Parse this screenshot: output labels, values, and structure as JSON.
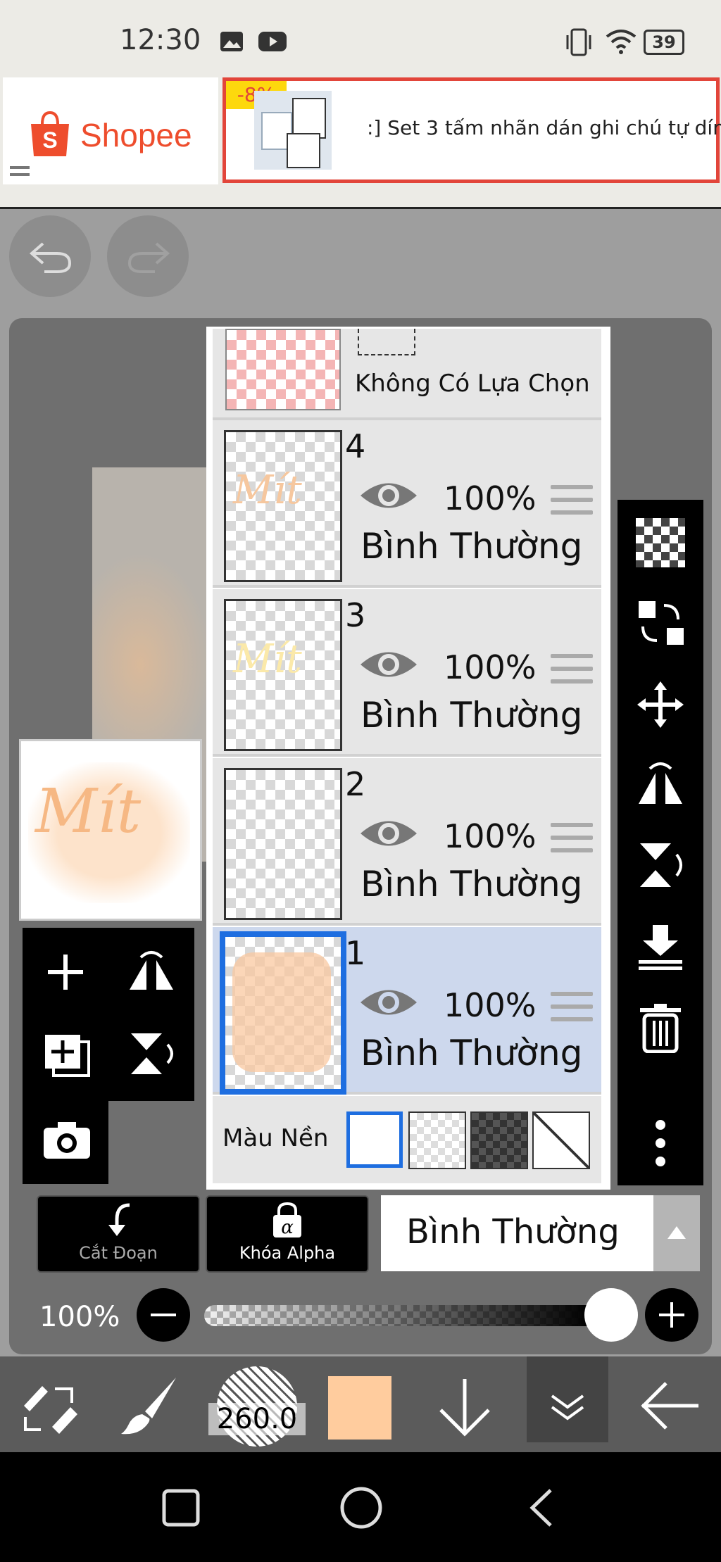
{
  "status_bar": {
    "time": "12:30",
    "battery": "39"
  },
  "ad": {
    "brand": "Shopee",
    "discount": "-8%",
    "product_text": ":] Set 3 tấm nhãn dán ghi chú tự dín"
  },
  "layers_panel": {
    "selection_label": "Không Có Lựa Chọn",
    "layers": [
      {
        "number": "4",
        "opacity": "100%",
        "blend": "Bình Thường",
        "selected": false
      },
      {
        "number": "3",
        "opacity": "100%",
        "blend": "Bình Thường",
        "selected": false
      },
      {
        "number": "2",
        "opacity": "100%",
        "blend": "Bình Thường",
        "selected": false
      },
      {
        "number": "1",
        "opacity": "100%",
        "blend": "Bình Thường",
        "selected": true
      }
    ],
    "background_label": "Màu Nền"
  },
  "preview": {
    "text": "Mít"
  },
  "controls": {
    "clip_label": "Cắt Đoạn",
    "alpha_lock_label": "Khóa Alpha",
    "blend_mode": "Bình Thường",
    "opacity_label": "100%",
    "opacity_value": 1.0
  },
  "bottom_toolbar": {
    "brush_size": "260.0",
    "color": "#ffcc9e"
  },
  "colors": {
    "accent": "#1e6ee0",
    "shopee": "#ee4d2d",
    "selected_layer": "#cdd8ed"
  }
}
